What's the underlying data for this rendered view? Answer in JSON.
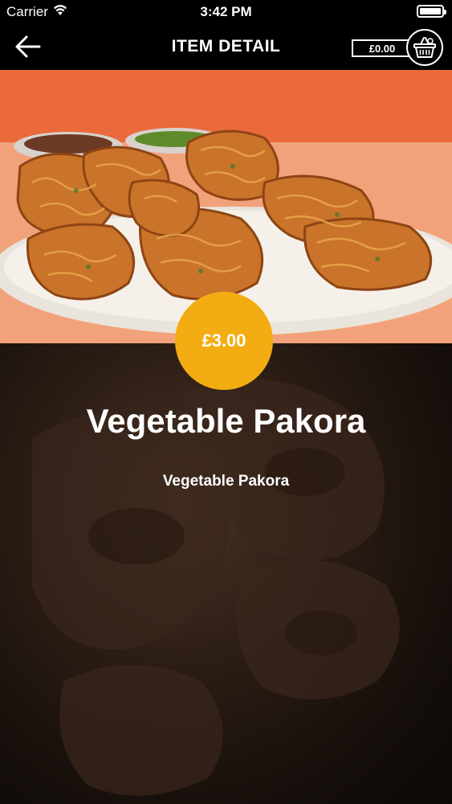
{
  "status_bar": {
    "carrier": "Carrier",
    "time": "3:42 PM"
  },
  "nav": {
    "title": "ITEM DETAIL",
    "cart_total": "£0.00"
  },
  "item": {
    "price": "£3.00",
    "name": "Vegetable Pakora",
    "description": "Vegetable Pakora"
  },
  "icons": {
    "back": "back-arrow-icon",
    "basket": "basket-icon",
    "wifi": "wifi-icon",
    "battery": "battery-icon"
  },
  "colors": {
    "accent": "#f3ad12",
    "nav_background": "#000000"
  }
}
